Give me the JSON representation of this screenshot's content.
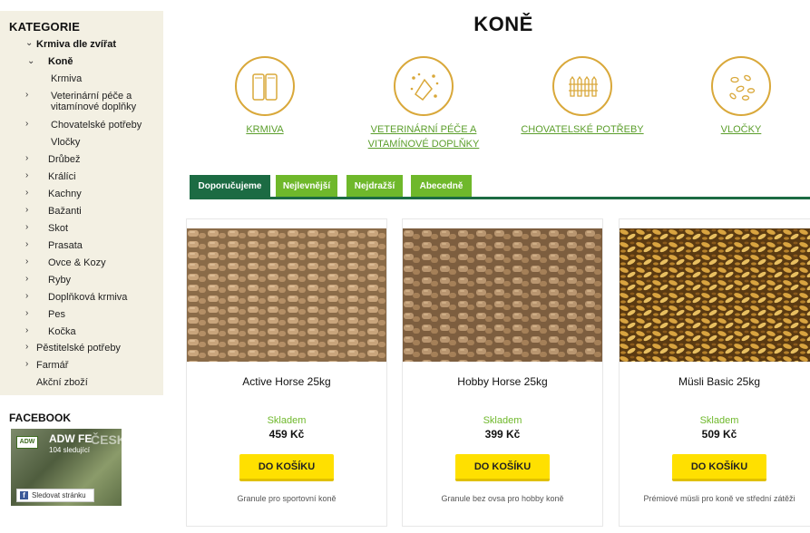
{
  "sidebar": {
    "title": "KATEGORIE",
    "items": [
      {
        "label": "Krmiva dle zvířat",
        "arrow": "⌄"
      },
      {
        "label": "Koně",
        "arrow": "⌄"
      },
      {
        "label": "Krmiva",
        "arrow": ""
      },
      {
        "label": "Veterinární péče a",
        "label2": "vitamínové doplňky",
        "arrow": "›"
      },
      {
        "label": "Chovatelské potřeby",
        "arrow": "›"
      },
      {
        "label": "Vločky",
        "arrow": ""
      },
      {
        "label": "Drůbež",
        "arrow": "›"
      },
      {
        "label": "Králíci",
        "arrow": "›"
      },
      {
        "label": "Kachny",
        "arrow": "›"
      },
      {
        "label": "Bažanti",
        "arrow": "›"
      },
      {
        "label": "Skot",
        "arrow": "›"
      },
      {
        "label": "Prasata",
        "arrow": "›"
      },
      {
        "label": "Ovce & Kozy",
        "arrow": "›"
      },
      {
        "label": "Ryby",
        "arrow": "›"
      },
      {
        "label": "Doplňková krmiva",
        "arrow": "›"
      },
      {
        "label": "Pes",
        "arrow": "›"
      },
      {
        "label": "Kočka",
        "arrow": "›"
      },
      {
        "label": "Pěstitelské potřeby",
        "arrow": "›"
      },
      {
        "label": "Farmář",
        "arrow": "›"
      },
      {
        "label": "Akční zboží",
        "arrow": ""
      }
    ]
  },
  "facebook": {
    "title": "FACEBOOK",
    "logo": "ADW",
    "page_name": "ADW FE",
    "followers": "104 sledující",
    "overlay": "ČESKÁ",
    "follow_label": "Sledovat stránku"
  },
  "page": {
    "title": "KONĚ"
  },
  "categories": [
    {
      "line1": "KRMIVA",
      "line2": "",
      "icon": "feed-bags-icon"
    },
    {
      "line1": "VETERINÁRNÍ PÉČE A",
      "line2": "VITAMÍNOVÉ DOPLŇKY",
      "icon": "vitamins-icon"
    },
    {
      "line1": "CHOVATELSKÉ POTŘEBY",
      "line2": "",
      "icon": "fence-icon"
    },
    {
      "line1": "VLOČKY",
      "line2": "",
      "icon": "flakes-icon"
    }
  ],
  "tabs": [
    {
      "label": "Doporučujeme",
      "active": true
    },
    {
      "label": "Nejlevnější",
      "active": false
    },
    {
      "label": "Nejdražší",
      "active": false
    },
    {
      "label": "Abecedně",
      "active": false
    }
  ],
  "products": [
    {
      "name": "Active Horse 25kg",
      "stock": "Skladem",
      "price": "459 Kč",
      "buy": "DO KOŠÍKU",
      "desc": "Granule pro sportovní koně",
      "image": "pellets"
    },
    {
      "name": "Hobby Horse 25kg",
      "stock": "Skladem",
      "price": "399 Kč",
      "buy": "DO KOŠÍKU",
      "desc": "Granule bez ovsa pro hobby koně",
      "image": "pellets"
    },
    {
      "name": "Müsli Basic 25kg",
      "stock": "Skladem",
      "price": "509 Kč",
      "buy": "DO KOŠÍKU",
      "desc": "Prémiové müsli pro koně ve střední zátěži",
      "image": "muesli"
    }
  ],
  "colors": {
    "accent_green": "#6fb82b",
    "dark_green": "#1c6b43",
    "button_yellow": "#ffe000",
    "icon_gold": "#d9a83a",
    "sidebar_bg": "#f3f0e3"
  }
}
